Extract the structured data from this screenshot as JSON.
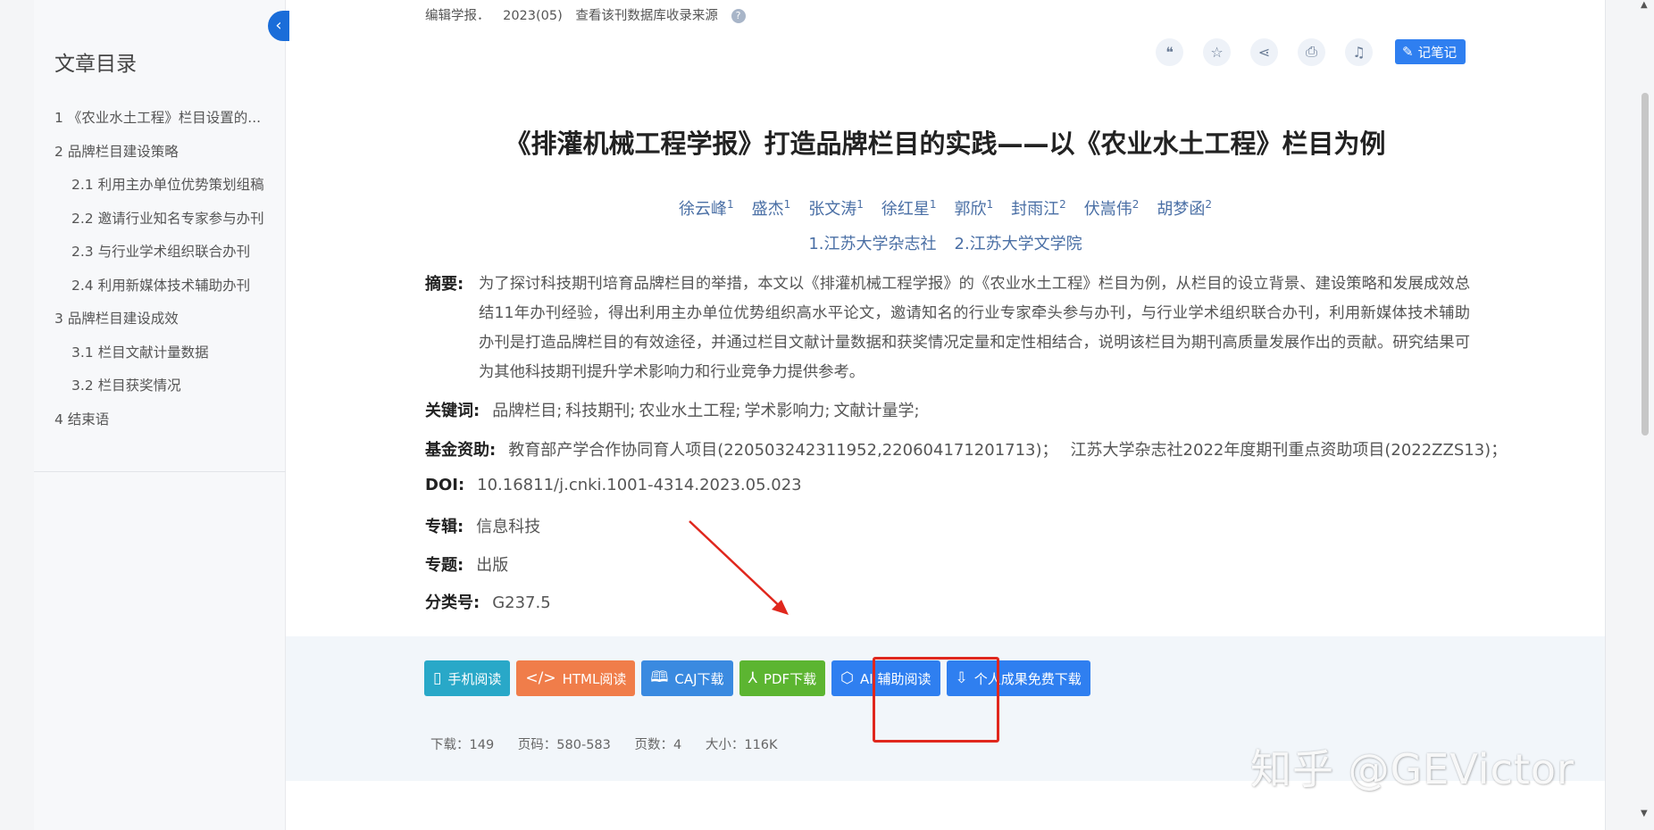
{
  "sidebar": {
    "title": "文章目录",
    "collapse_glyph": "‹",
    "items": [
      {
        "label": "1 《农业水土工程》栏目设置的...",
        "level": 1
      },
      {
        "label": "2 品牌栏目建设策略",
        "level": 1
      },
      {
        "label": "2.1 利用主办单位优势策划组稿",
        "level": 2
      },
      {
        "label": "2.2 邀请行业知名专家参与办刊",
        "level": 2
      },
      {
        "label": "2.3 与行业学术组织联合办刊",
        "level": 2
      },
      {
        "label": "2.4 利用新媒体技术辅助办刊",
        "level": 2
      },
      {
        "label": "3 品牌栏目建设成效",
        "level": 1
      },
      {
        "label": "3.1 栏目文献计量数据",
        "level": 2
      },
      {
        "label": "3.2 栏目获奖情况",
        "level": 2
      },
      {
        "label": "4 结束语",
        "level": 1
      }
    ]
  },
  "source": {
    "journal": "编辑学报．",
    "issue": "2023(05)",
    "link": "查看该刊数据库收录来源",
    "help_glyph": "?"
  },
  "toolbar": {
    "icons": [
      {
        "name": "quote-icon",
        "glyph": "❝"
      },
      {
        "name": "star-icon",
        "glyph": "☆"
      },
      {
        "name": "share-icon",
        "glyph": "⋖"
      },
      {
        "name": "print-icon",
        "glyph": "⎙"
      },
      {
        "name": "bell-icon",
        "glyph": "♫"
      }
    ],
    "note_label": "记笔记",
    "note_glyph": "✎"
  },
  "article": {
    "title": "《排灌机械工程学报》打造品牌栏目的实践——以《农业水土工程》栏目为例",
    "authors": [
      {
        "name": "徐云峰",
        "sup": "1"
      },
      {
        "name": "盛杰",
        "sup": "1"
      },
      {
        "name": "张文涛",
        "sup": "1"
      },
      {
        "name": "徐红星",
        "sup": "1"
      },
      {
        "name": "郭欣",
        "sup": "1"
      },
      {
        "name": "封雨江",
        "sup": "2"
      },
      {
        "name": "伏嵩伟",
        "sup": "2"
      },
      {
        "name": "胡梦函",
        "sup": "2"
      }
    ],
    "affiliations": [
      "1.江苏大学杂志社",
      "2.江苏大学文学院"
    ],
    "abstract_label": "摘要:",
    "abstract": "为了探讨科技期刊培育品牌栏目的举措，本文以《排灌机械工程学报》的《农业水土工程》栏目为例，从栏目的设立背景、建设策略和发展成效总结11年办刊经验，得出利用主办单位优势组织高水平论文，邀请知名的行业专家牵头参与办刊，与行业学术组织联合办刊，利用新媒体技术辅助办刊是打造品牌栏目的有效途径，并通过栏目文献计量数据和获奖情况定量和定性相结合，说明该栏目为期刊高质量发展作出的贡献。研究结果可为其他科技期刊提升学术影响力和行业竞争力提供参考。",
    "keywords_label": "关键词:",
    "keywords": [
      "品牌栏目;",
      "科技期刊;",
      "农业水土工程;",
      "学术影响力;",
      "文献计量学;"
    ],
    "fund_label": "基金资助:",
    "funds": [
      "教育部产学合作协同育人项目(220503242311952,220604171201713)；",
      "江苏大学杂志社2022年度期刊重点资助项目(2022ZZS13)；"
    ],
    "doi_label": "DOI:",
    "doi": "10.16811/j.cnki.1001-4314.2023.05.023",
    "series_label": "专辑:",
    "series": "信息科技",
    "topic_label": "专题:",
    "topic": "出版",
    "class_label": "分类号:",
    "class": "G237.5"
  },
  "downloads": {
    "buttons": [
      {
        "name": "mobile-read-button",
        "label": "手机阅读",
        "icon": "▯",
        "color": "#29a8c8"
      },
      {
        "name": "html-read-button",
        "label": "HTML阅读",
        "icon": "</>",
        "color": "#f07d4a"
      },
      {
        "name": "caj-download-button",
        "label": "CAJ下载",
        "icon": "🕮",
        "color": "#3a8ae0"
      },
      {
        "name": "pdf-download-button",
        "label": "PDF下载",
        "icon": "⅄",
        "color": "#5cb531"
      },
      {
        "name": "ai-read-button",
        "label": "AI 辅助阅读",
        "icon": "⬡",
        "color": "#2f7ff0"
      },
      {
        "name": "free-download-button",
        "label": "个人成果免费下载",
        "icon": "⇩",
        "color": "#2f7ff0"
      }
    ],
    "stats": {
      "downloads": "下载：149",
      "pages": "页码：580-583",
      "page_count": "页数：4",
      "size": "大小：116K"
    }
  },
  "annotation": {
    "arrow_color": "#e0271d"
  },
  "watermark": "知乎 @GEVictor"
}
